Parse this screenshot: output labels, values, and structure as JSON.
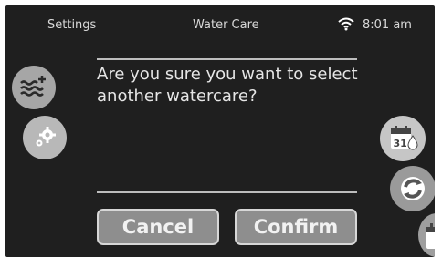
{
  "topbar": {
    "left": "Settings",
    "center": "Water Care",
    "time": "8:01 am"
  },
  "dialog": {
    "message": "Are you sure you want to select another watercare?",
    "cancel_label": "Cancel",
    "confirm_label": "Confirm"
  },
  "icons": {
    "water": "water-care-add-icon",
    "settings": "gear-icon",
    "calendar": "calendar-water-icon",
    "sync": "sync-icon",
    "calendar_partial": "calendar-icon"
  },
  "calendar_day": "31",
  "colors": {
    "background": "#1f1f1f",
    "button": "#8e8e8e",
    "button_border": "#d7d7d7",
    "text": "#e6e6e6",
    "icon_bg": "#a6a6a6"
  }
}
